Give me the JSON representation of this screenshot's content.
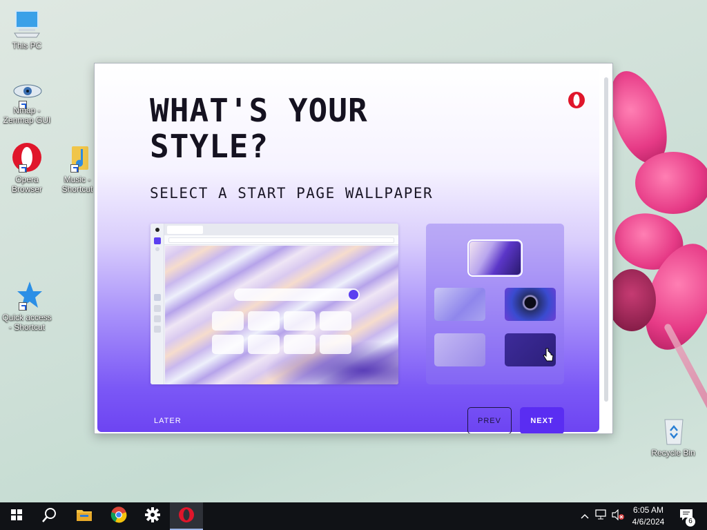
{
  "desktop": {
    "icons": [
      {
        "label": "This PC"
      },
      {
        "label": "Nmap -\nZenmap GUI"
      },
      {
        "label": "Opera\nBrowser"
      },
      {
        "label": "Music -\nShortcut"
      },
      {
        "label": "Quick access\n- Shortcut"
      },
      {
        "label": "Recycle Bin"
      }
    ]
  },
  "installer": {
    "headline": "WHAT'S YOUR STYLE?",
    "subhead": "SELECT A START PAGE WALLPAPER",
    "later_label": "LATER",
    "prev_label": "PREV",
    "next_label": "NEXT",
    "wallpapers": [
      {
        "name": "purple-marble",
        "selected": true
      },
      {
        "name": "lavender-blur",
        "selected": false
      },
      {
        "name": "aurora-orb",
        "selected": false
      },
      {
        "name": "soft-violet",
        "selected": false
      },
      {
        "name": "deep-indigo",
        "selected": false
      }
    ],
    "colors": {
      "accent": "#5a2df2",
      "opera_red": "#e0162b"
    }
  },
  "taskbar": {
    "pinned": [
      "start-icon",
      "search-icon",
      "file-explorer-icon",
      "chrome-icon",
      "settings-icon",
      "opera-icon"
    ],
    "time": "6:05 AM",
    "date": "4/6/2024",
    "notification_count": "6"
  }
}
